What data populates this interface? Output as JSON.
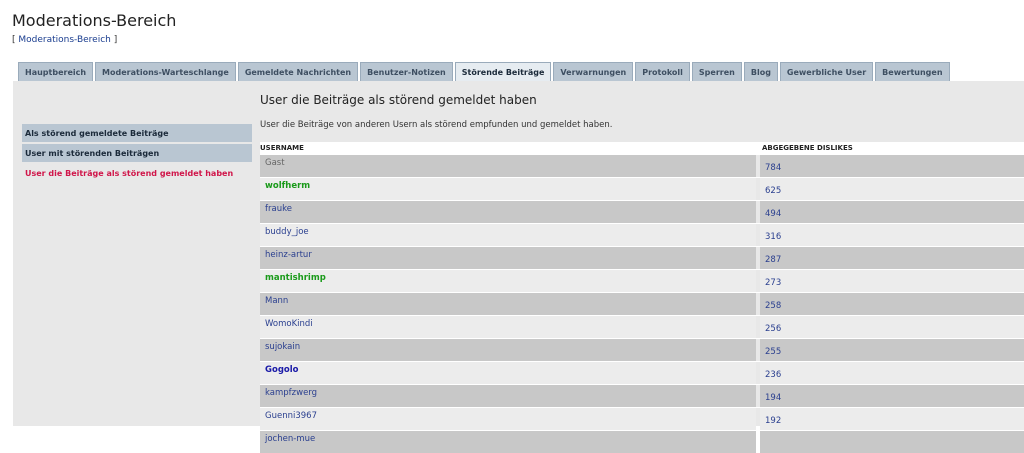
{
  "header": {
    "title": "Moderations-Bereich",
    "breadcrumb_open": "[ ",
    "breadcrumb_link": "Moderations-Bereich",
    "breadcrumb_close": " ]"
  },
  "tabs": [
    {
      "label": "Hauptbereich"
    },
    {
      "label": "Moderations-Warteschlange"
    },
    {
      "label": "Gemeldete Nachrichten"
    },
    {
      "label": "Benutzer-Notizen"
    },
    {
      "label": "Störende Beiträge",
      "active": true
    },
    {
      "label": "Verwarnungen"
    },
    {
      "label": "Protokoll"
    },
    {
      "label": "Sperren"
    },
    {
      "label": "Blog"
    },
    {
      "label": "Gewerbliche User"
    },
    {
      "label": "Bewertungen"
    }
  ],
  "sidebar": {
    "items": [
      {
        "label": "Als störend gemeldete Beiträge"
      },
      {
        "label": "User mit störenden Beiträgen"
      },
      {
        "label": "User die Beiträge als störend gemeldet haben",
        "active": true
      }
    ]
  },
  "main": {
    "title": "User die Beiträge als störend gemeldet haben",
    "description": "User die Beiträge von anderen Usern als störend empfunden und gemeldet haben.",
    "columns": {
      "username": "USERNAME",
      "dislikes": "ABGEGEBENE DISLIKES"
    },
    "rows": [
      {
        "username": "Gast",
        "dislikes": "784",
        "style": "gray"
      },
      {
        "username": "wolfherm",
        "dislikes": "625",
        "style": "green"
      },
      {
        "username": "frauke",
        "dislikes": "494",
        "style": ""
      },
      {
        "username": "buddy_joe",
        "dislikes": "316",
        "style": ""
      },
      {
        "username": "heinz-artur",
        "dislikes": "287",
        "style": ""
      },
      {
        "username": "mantishrimp",
        "dislikes": "273",
        "style": "green"
      },
      {
        "username": "Mann",
        "dislikes": "258",
        "style": ""
      },
      {
        "username": "WomoKindi",
        "dislikes": "256",
        "style": ""
      },
      {
        "username": "sujokain",
        "dislikes": "255",
        "style": ""
      },
      {
        "username": "Gogolo",
        "dislikes": "236",
        "style": "blue"
      },
      {
        "username": "kampfzwerg",
        "dislikes": "194",
        "style": ""
      },
      {
        "username": "Guenni3967",
        "dislikes": "192",
        "style": ""
      },
      {
        "username": "jochen-mue",
        "dislikes": "",
        "style": ""
      }
    ]
  }
}
